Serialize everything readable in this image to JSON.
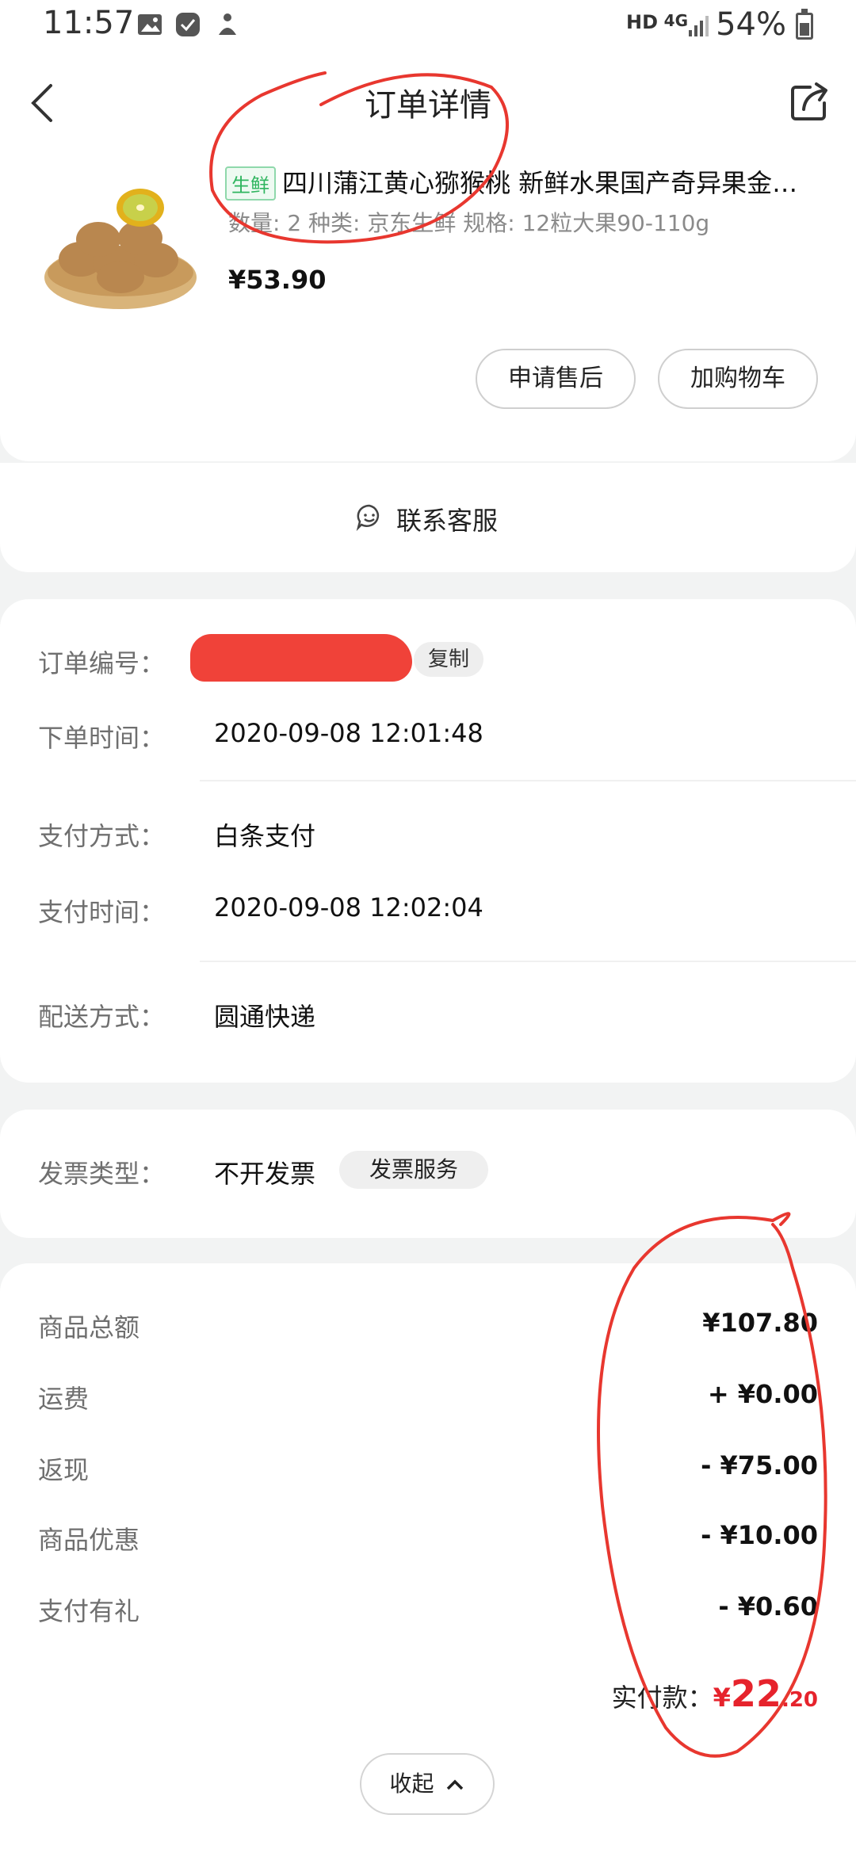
{
  "status_bar": {
    "time": "11:57",
    "hd": "HD",
    "network": "4G",
    "battery": "54%"
  },
  "header": {
    "title": "订单详情"
  },
  "product": {
    "tag": "生鲜",
    "name": "四川蒲江黄心猕猴桃 新鲜水果国产奇异果金…",
    "spec": "数量: 2  种类: 京东生鲜  规格: 12粒大果90-110g",
    "price": "¥53.90",
    "after_sale": "申请售后",
    "add_cart": "加购物车"
  },
  "customer_service": {
    "label": "联系客服"
  },
  "order_info": {
    "order_no_label": "订单编号：",
    "copy": "复制",
    "order_time_label": "下单时间：",
    "order_time": "2020-09-08  12:01:48",
    "pay_method_label": "支付方式：",
    "pay_method": "白条支付",
    "pay_time_label": "支付时间：",
    "pay_time": "2020-09-08  12:02:04",
    "delivery_label": "配送方式：",
    "delivery": "圆通快递"
  },
  "invoice": {
    "type_label": "发票类型：",
    "type": "不开发票",
    "service": "发票服务"
  },
  "amounts": {
    "rows": [
      {
        "label": "商品总额",
        "value": "¥107.80"
      },
      {
        "label": "运费",
        "value": "+ ¥0.00"
      },
      {
        "label": "返现",
        "value": "- ¥75.00"
      },
      {
        "label": "商品优惠",
        "value": "- ¥10.00"
      },
      {
        "label": "支付有礼",
        "value": "- ¥0.60"
      }
    ],
    "paid_label": "实付款：",
    "paid_yen": "¥",
    "paid_int": "22",
    "paid_dec": ".20",
    "collapse": "收起"
  },
  "colors": {
    "price_red": "#e6232c",
    "annotation_red": "#e8372f",
    "fresh_green": "#2fb55f"
  }
}
